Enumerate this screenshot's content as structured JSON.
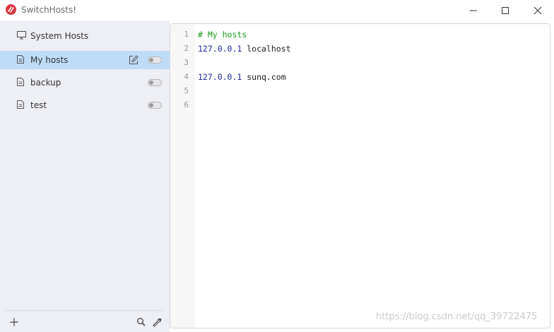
{
  "app": {
    "title": "SwitchHosts!"
  },
  "sidebar": {
    "system_item": {
      "label": "System Hosts",
      "icon": "monitor-icon"
    },
    "items": [
      {
        "label": "My hosts",
        "selected": true,
        "enabled": false
      },
      {
        "label": "backup",
        "selected": false,
        "enabled": false
      },
      {
        "label": "test",
        "selected": false,
        "enabled": false
      }
    ]
  },
  "editor": {
    "lines": [
      {
        "number": "1",
        "comment": "# My hosts",
        "ip": "",
        "host": ""
      },
      {
        "number": "2",
        "comment": "",
        "ip": "127.0.0.1",
        "host": " localhost"
      },
      {
        "number": "3",
        "comment": "",
        "ip": "",
        "host": ""
      },
      {
        "number": "4",
        "comment": "",
        "ip": "127.0.0.1",
        "host": " sunq.com"
      },
      {
        "number": "5",
        "comment": "",
        "ip": "",
        "host": ""
      },
      {
        "number": "6",
        "comment": "",
        "ip": "",
        "host": ""
      }
    ]
  },
  "watermark": "https://blog.csdn.net/qq_39722475",
  "colors": {
    "selected": "#bfdcf7",
    "sidebar_bg": "#eeeff4",
    "comment": "#1a9a1a",
    "ip": "#1f2a9c"
  }
}
